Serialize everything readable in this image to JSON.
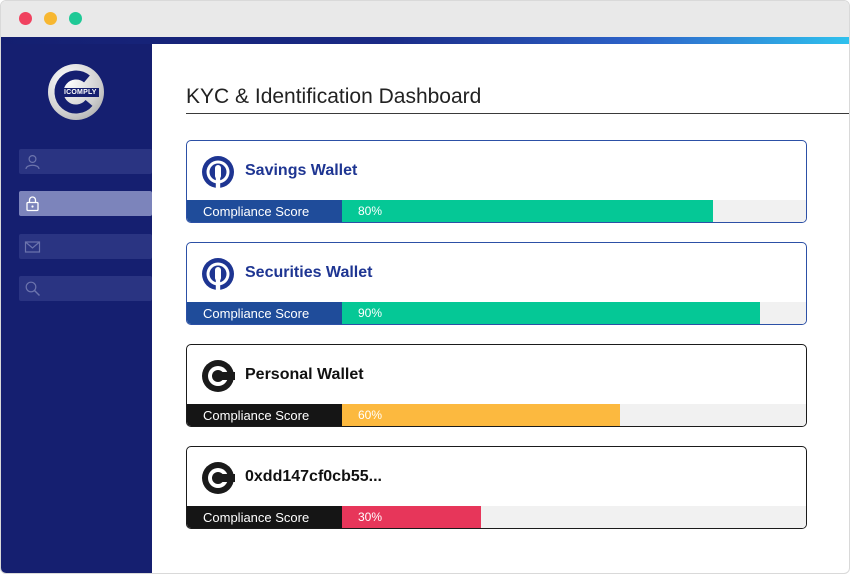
{
  "app": {
    "logo_text": "ICOMPLY"
  },
  "sidebar": {
    "items": [
      {
        "name": "user-icon",
        "active": false
      },
      {
        "name": "lock-icon",
        "active": true
      },
      {
        "name": "mail-icon",
        "active": false
      },
      {
        "name": "search-icon",
        "active": false
      }
    ]
  },
  "main": {
    "title": "KYC & Identification Dashboard"
  },
  "wallets": [
    {
      "name": "Savings Wallet",
      "score_label": "Compliance Score",
      "score_text": "80%",
      "score": 80,
      "color": "#05c896",
      "theme": "blue"
    },
    {
      "name": "Securities Wallet",
      "score_label": "Compliance Score",
      "score_text": "90%",
      "score": 90,
      "color": "#05c896",
      "theme": "blue"
    },
    {
      "name": "Personal Wallet",
      "score_label": "Compliance Score",
      "score_text": "60%",
      "score": 60,
      "color": "#fcb93f",
      "theme": "dark"
    },
    {
      "name": "0xdd147cf0cb55...",
      "score_label": "Compliance Score",
      "score_text": "30%",
      "score": 30,
      "color": "#e7365a",
      "theme": "dark"
    }
  ],
  "colors": {
    "sidebar": "#151f70",
    "accent_blue": "#1f4c9a",
    "card_blue_title": "#1e3592",
    "green": "#05c896",
    "orange": "#fcb93f",
    "red": "#e7365a"
  }
}
